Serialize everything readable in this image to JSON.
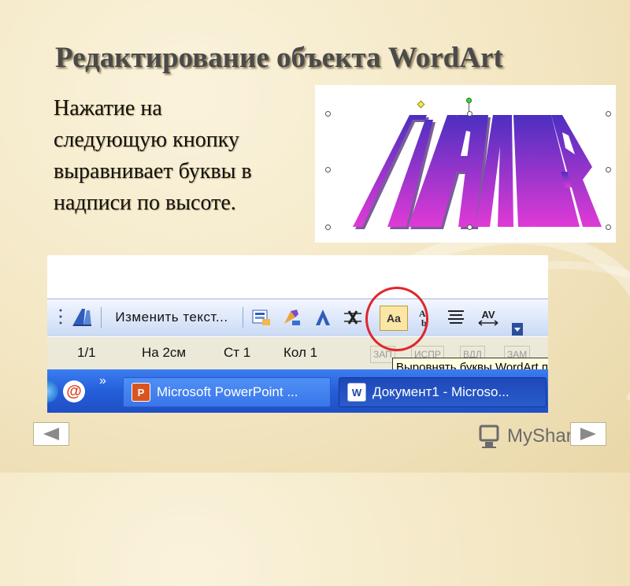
{
  "slide": {
    "title": "Редактирование объекта WordArt",
    "description": [
      "Нажатие на",
      "следующую кнопку",
      "выравнивает буквы в",
      "надписи по высоте."
    ]
  },
  "wordart": {
    "letters": [
      "П",
      "Р",
      "И",
      "М",
      "Е",
      "Р"
    ],
    "gradient_top": "#4b2fc0",
    "gradient_bottom": "#e03ad6"
  },
  "toolbar": {
    "edit_text_label": "Изменить текст...",
    "icons": [
      "wordart-insert-icon",
      "wordart-gallery-icon",
      "format-wordart-icon",
      "wordart-shape-icon",
      "text-wrapping-icon",
      "same-letter-heights-icon",
      "vertical-text-icon",
      "alignment-icon",
      "character-spacing-icon",
      "toolbar-options-icon"
    ],
    "same_height_glyph": "Aa",
    "spacing_glyph": "AV"
  },
  "statusbar": {
    "page": "1/1",
    "position": "На 2см",
    "line": "Ст 1",
    "column": "Кол 1",
    "indicators": [
      "ЗАП",
      "ИСПР",
      "ВДЛ",
      "ЗАМ"
    ]
  },
  "tooltip": {
    "text": "Выровнять буквы WordArt по высоте"
  },
  "taskbar": {
    "chevron": "»",
    "items": [
      {
        "label": "Microsoft PowerPoint ...",
        "active": false
      },
      {
        "label": "Документ1 - Microso...",
        "active": true
      }
    ]
  },
  "nav": {
    "prev_icon": "triangle-left-icon",
    "next_icon": "triangle-right-icon"
  },
  "logo": {
    "text": "MyShared"
  },
  "colors": {
    "highlight": "#e0262b",
    "taskbar": "#245edb"
  }
}
